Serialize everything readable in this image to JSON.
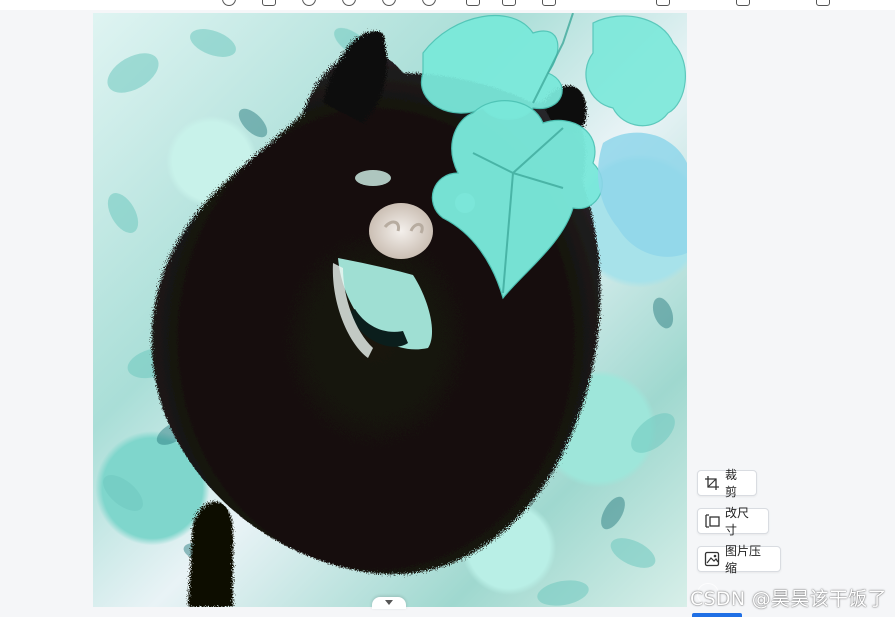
{
  "toolbar": {
    "icons": [
      "info-icon",
      "frame-icon",
      "zoom-in-icon",
      "zoom-out-icon",
      "rotate-left-icon",
      "rotate-right-icon",
      "copy-icon",
      "paste-icon",
      "delete-icon"
    ],
    "labels": [
      "",
      "",
      ""
    ]
  },
  "image": {
    "description_icon": "inverted-dog-photo"
  },
  "edit_panel": {
    "crop_label": "裁剪",
    "resize_label": "改尺寸",
    "compress_label": "图片压缩"
  },
  "watermark": "CSDN @昊昊该干饭了",
  "colors": {
    "accent": "#1f6fe5",
    "button_border": "#d9dce1",
    "background": "#f5f6f8"
  }
}
